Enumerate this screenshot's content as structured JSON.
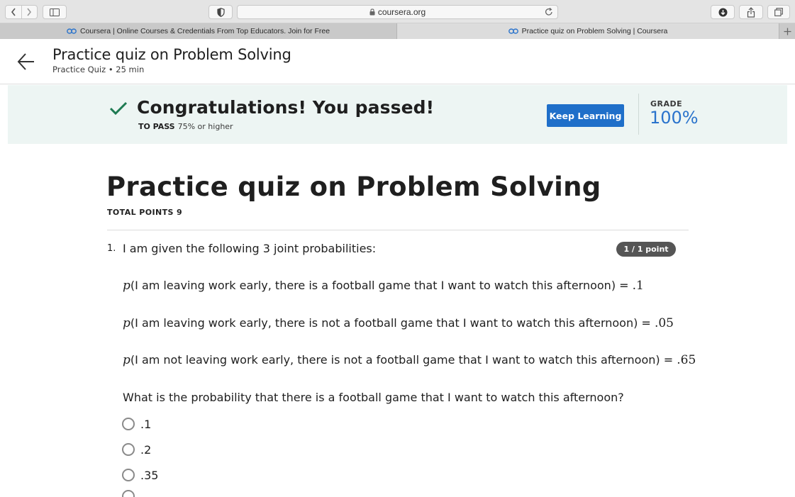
{
  "browser": {
    "url": "coursera.org",
    "tabs": [
      {
        "label": "Coursera | Online Courses & Credentials From Top Educators. Join for Free",
        "active": false
      },
      {
        "label": "Practice quiz on Problem Solving | Coursera",
        "active": true
      }
    ]
  },
  "header": {
    "title": "Practice quiz on Problem Solving",
    "subtitle": "Practice Quiz • 25 min"
  },
  "result": {
    "message": "Congratulations! You passed!",
    "to_pass_label": "TO PASS",
    "to_pass_value": "75% or higher",
    "keep_learning_label": "Keep Learning",
    "grade_label": "GRADE",
    "grade_value": "100%",
    "accent_color": "#1f6fc9",
    "banner_color": "#edf5f3"
  },
  "quiz": {
    "title": "Practice quiz on Problem Solving",
    "total_points": "TOTAL POINTS 9",
    "questions": [
      {
        "number": "1.",
        "text": "I am given the following 3 joint probabilities:",
        "points": "1 / 1 point",
        "probabilities": [
          {
            "p": "p",
            "text": "(I am leaving work early, there is a football game that I want to watch this afternoon) =",
            "value": ".1"
          },
          {
            "p": "p",
            "text": "(I am leaving work early, there is not a football game that I want to watch this afternoon) =",
            "value": ".05"
          },
          {
            "p": "p",
            "text": "(I am not leaving work early, there is not a football game that I want to watch this afternoon) =",
            "value": ".65"
          }
        ],
        "prompt": "What is the probability that there is a football game that I want to watch this afternoon?",
        "options": [
          ".1",
          ".2",
          ".35",
          ""
        ]
      }
    ]
  }
}
